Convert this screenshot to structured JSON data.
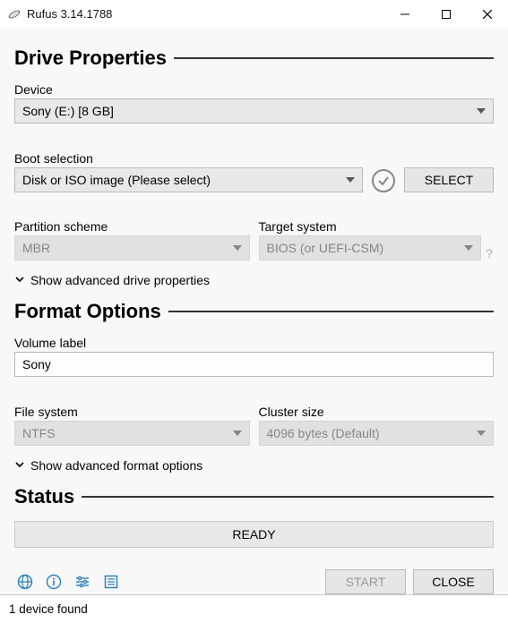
{
  "window": {
    "title": "Rufus 3.14.1788"
  },
  "sections": {
    "drive_props": "Drive Properties",
    "format_opts": "Format Options",
    "status": "Status"
  },
  "labels": {
    "device": "Device",
    "boot_selection": "Boot selection",
    "partition_scheme": "Partition scheme",
    "target_system": "Target system",
    "volume_label": "Volume label",
    "file_system": "File system",
    "cluster_size": "Cluster size"
  },
  "values": {
    "device": "Sony (E:) [8 GB]",
    "boot_selection": "Disk or ISO image (Please select)",
    "partition_scheme": "MBR",
    "target_system": "BIOS (or UEFI-CSM)",
    "volume_label": "Sony",
    "file_system": "NTFS",
    "cluster_size": "4096 bytes (Default)"
  },
  "buttons": {
    "select": "SELECT",
    "start": "START",
    "close": "CLOSE"
  },
  "disclosure": {
    "drive": "Show advanced drive properties",
    "format": "Show advanced format options"
  },
  "status_text": "READY",
  "statusbar_text": "1 device found",
  "icons": {
    "lang": "globe-icon",
    "info": "info-icon",
    "settings": "sliders-icon",
    "log": "log-icon"
  },
  "colors": {
    "accent": "#2a7db8",
    "field_bg": "#e8e8e8",
    "disabled_bg": "#d8d8d8"
  }
}
